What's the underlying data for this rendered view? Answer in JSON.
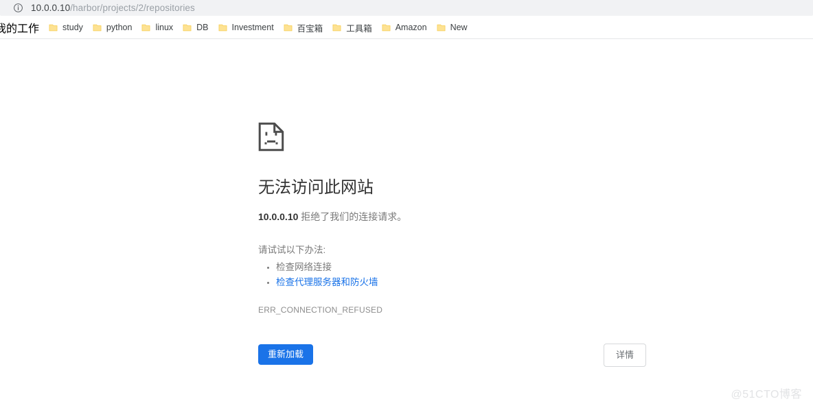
{
  "omnibox": {
    "info_icon": "info-circle-icon",
    "url_host": "10.0.0.10",
    "url_path": "/harbor/projects/2/repositories"
  },
  "bookmarks": {
    "folder_icon": "folder-icon",
    "items": [
      {
        "label": "我的工作"
      },
      {
        "label": "study"
      },
      {
        "label": "python"
      },
      {
        "label": "linux"
      },
      {
        "label": "DB"
      },
      {
        "label": "Investment"
      },
      {
        "label": "百宝箱"
      },
      {
        "label": "工具箱"
      },
      {
        "label": "Amazon"
      },
      {
        "label": "New"
      }
    ]
  },
  "error_page": {
    "icon": "sad-document-icon",
    "title": "无法访问此网站",
    "subtitle_host": "10.0.0.10",
    "subtitle_rest": " 拒绝了我们的连接请求。",
    "suggest_title": "请试试以下办法:",
    "suggestions": [
      {
        "label": "检查网络连接",
        "link": false
      },
      {
        "label": "检查代理服务器和防火墙",
        "link": true
      }
    ],
    "error_code": "ERR_CONNECTION_REFUSED",
    "reload_label": "重新加载",
    "details_label": "详情",
    "accent_color": "#1a73e8",
    "link_color": "#1a73e8"
  },
  "watermark": {
    "text": "@51CTO博客"
  }
}
